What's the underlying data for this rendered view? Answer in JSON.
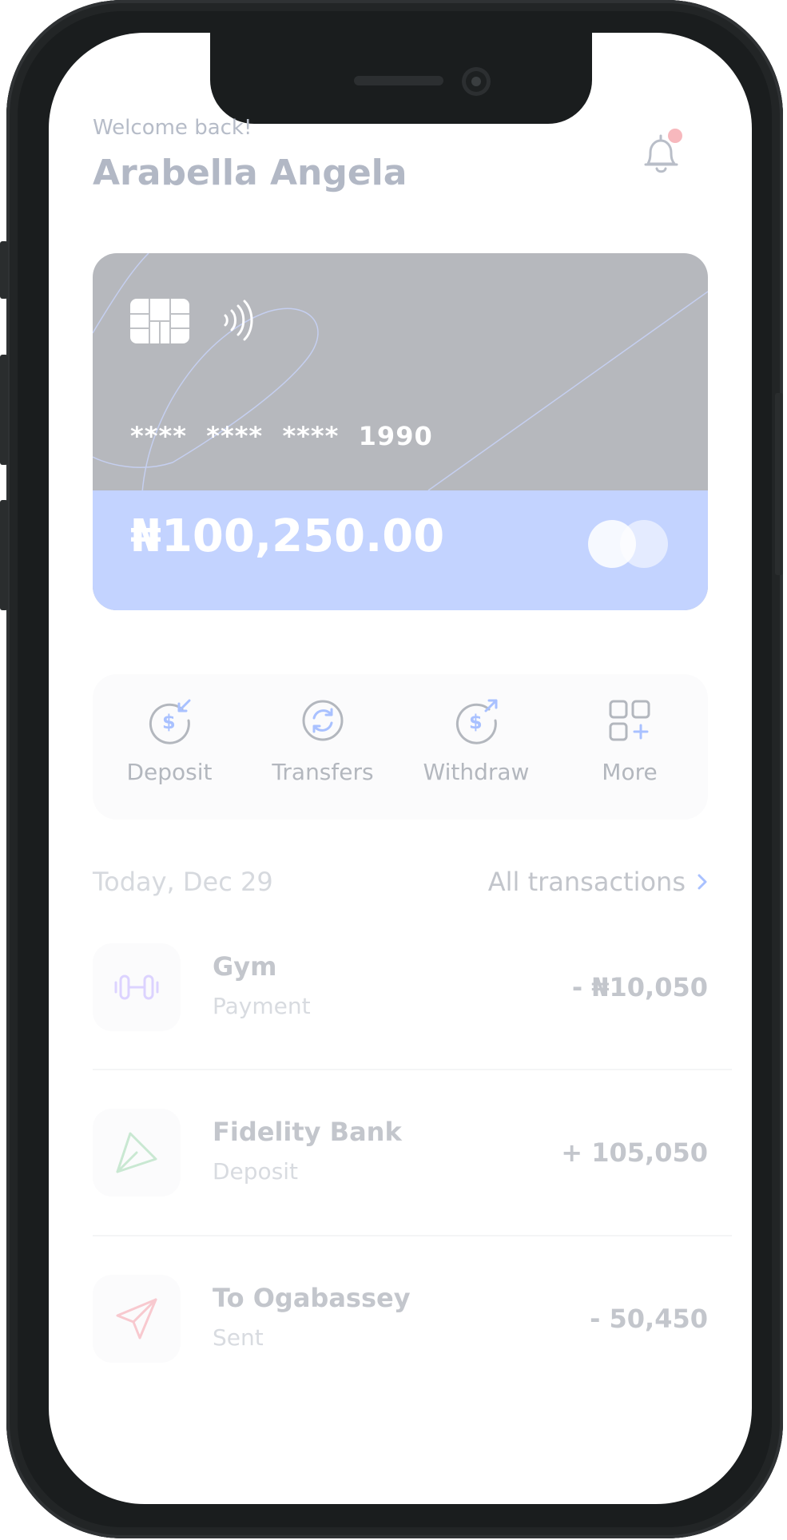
{
  "header": {
    "greeting": "Welcome back!",
    "user_name": "Arabella Angela",
    "notification_icon": "bell-icon",
    "notification_dot_color": "#f7b8bd"
  },
  "card": {
    "number_masked": "****  ****  ****  1990",
    "balance": "₦100,250.00",
    "brand_icon": "mastercard-icon",
    "colors": {
      "top": "#b6b8bd",
      "bottom": "#c3d3ff"
    }
  },
  "actions": [
    {
      "label": "Deposit",
      "icon": "deposit-icon"
    },
    {
      "label": "Transfers",
      "icon": "transfer-icon"
    },
    {
      "label": "Withdraw",
      "icon": "withdraw-icon"
    },
    {
      "label": "More",
      "icon": "grid-plus-icon"
    }
  ],
  "transactions_section": {
    "date": "Today, Dec 29",
    "all_link": "All transactions"
  },
  "transactions": [
    {
      "title": "Gym",
      "subtitle": "Payment",
      "amount": "- ₦10,050",
      "icon": "dumbbell-icon"
    },
    {
      "title": "Fidelity Bank",
      "subtitle": "Deposit",
      "amount": "+ 105,050",
      "icon": "received-arrow-icon"
    },
    {
      "title": "To Ogabassey",
      "subtitle": "Sent",
      "amount": "- 50,450",
      "icon": "send-icon"
    }
  ]
}
